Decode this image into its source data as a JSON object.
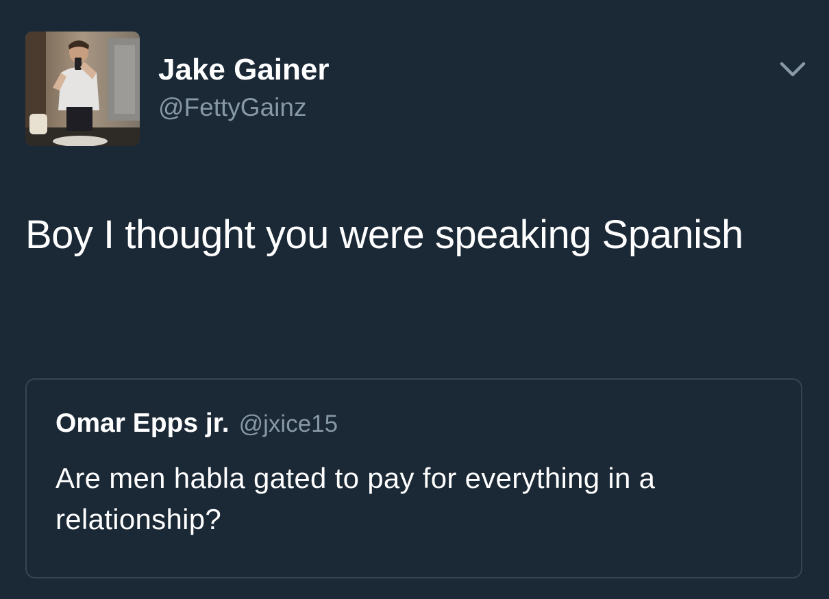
{
  "tweet": {
    "author": {
      "display_name": "Jake Gainer",
      "handle": "@FettyGainz",
      "avatar_icon": "profile-photo"
    },
    "menu_icon": "chevron-down-icon",
    "text": "Boy I thought you were speaking Spanish",
    "quoted_tweet": {
      "display_name": "Omar Epps jr.",
      "handle": "@jxice15",
      "text": "Are men habla gated to pay for everything in a relationship?"
    }
  },
  "colors": {
    "background": "#1b2836",
    "primary_text": "#ffffff",
    "secondary_text": "#8899a6",
    "card_border": "#38444d"
  }
}
